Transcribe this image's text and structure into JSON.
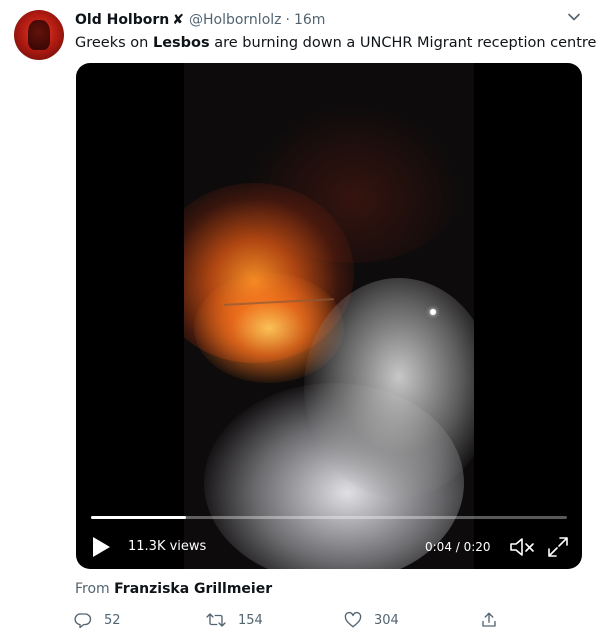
{
  "tweet": {
    "author_name": "Old Holborn",
    "author_suffix": "✘",
    "handle": "@Holbornlolz",
    "separator": "·",
    "time": "16m",
    "text_before": "Greeks on ",
    "text_bold": "Lesbos",
    "text_after": " are burning down a UNCHR Migrant reception centre"
  },
  "video": {
    "views": "11.3K views",
    "timecode": "0:04 / 0:20",
    "progress": 0.2
  },
  "from": {
    "label": "From",
    "source": "Franziska Grillmeier"
  },
  "actions": {
    "replies": "52",
    "retweets": "154",
    "likes": "304"
  },
  "icons": [
    "avatar",
    "chevron-down-icon",
    "play-icon",
    "mute-icon",
    "fullscreen-icon",
    "reply-icon",
    "retweet-icon",
    "like-icon",
    "share-icon"
  ],
  "colors": {
    "text": "#0f1419",
    "secondary": "#536471"
  }
}
